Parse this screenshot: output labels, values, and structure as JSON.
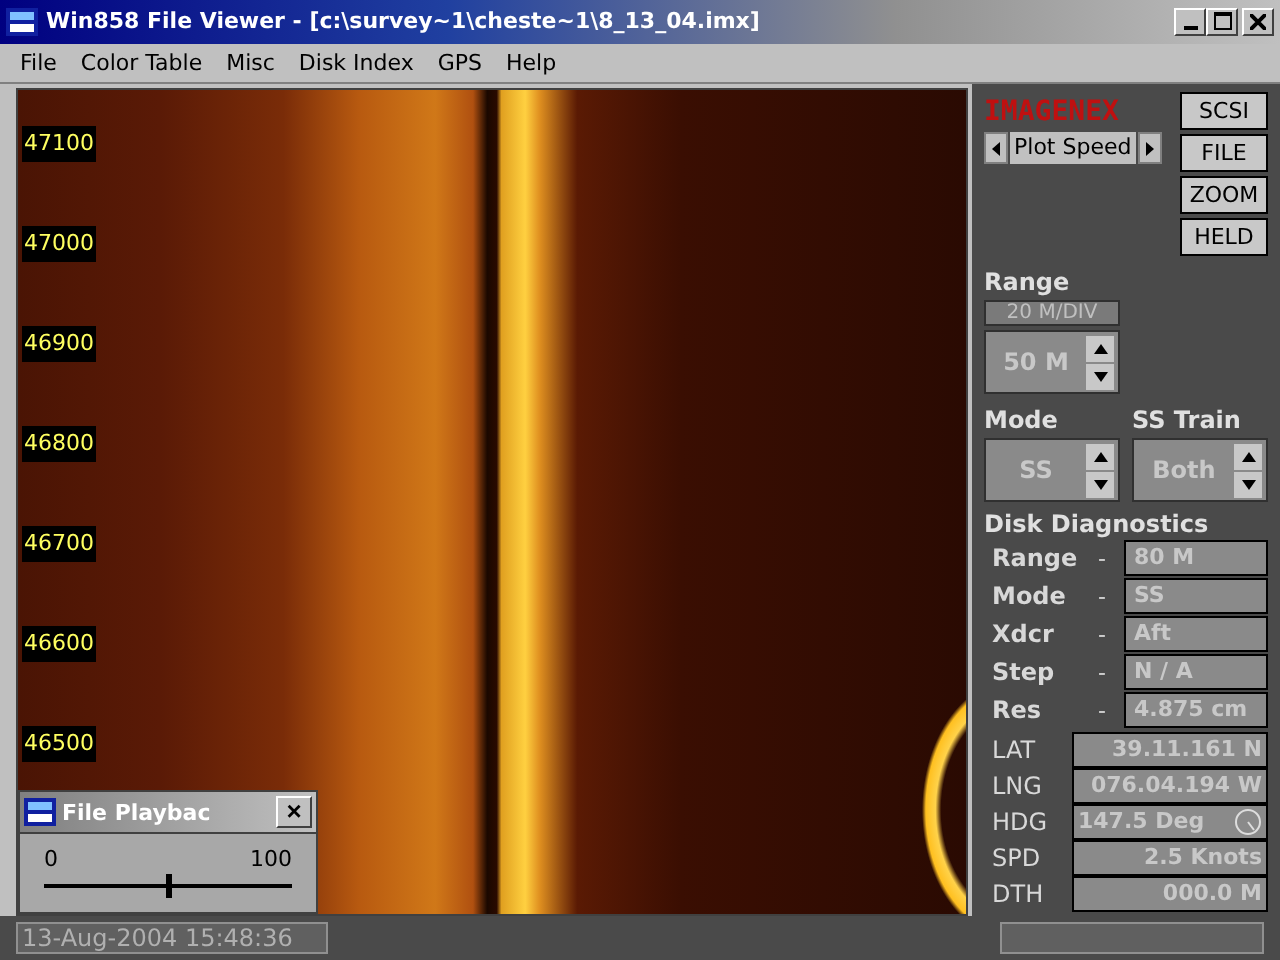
{
  "window": {
    "title": "Win858 File Viewer - [c:\\survey~1\\cheste~1\\8_13_04.imx]"
  },
  "menu": [
    "File",
    "Color Table",
    "Misc",
    "Disk Index",
    "GPS",
    "Help"
  ],
  "depth_markers": [
    "47100",
    "47000",
    "46900",
    "46800",
    "46700",
    "46600",
    "46500"
  ],
  "playback": {
    "title": "File Playbac",
    "min": "0",
    "max": "100",
    "close": "×",
    "level": 0.5
  },
  "status": {
    "datetime": "13-Aug-2004  15:48:36"
  },
  "panel": {
    "logo": "IMAGENEX",
    "plot_speed": "Plot Speed",
    "buttons": [
      "SCSI",
      "FILE",
      "ZOOM",
      "HELD"
    ],
    "range": {
      "label": "Range",
      "division": "20 M/DIV",
      "value": "50 M"
    },
    "mode": {
      "label": "Mode",
      "value": "SS"
    },
    "ss_train": {
      "label": "SS Train",
      "value": "Both"
    },
    "diagnostics": {
      "title": "Disk Diagnostics",
      "rows": [
        {
          "label": "Range",
          "separator": "-",
          "value": "80 M"
        },
        {
          "label": "Mode",
          "separator": "-",
          "value": "SS"
        },
        {
          "label": "Xdcr",
          "separator": "-",
          "value": "Aft"
        },
        {
          "label": "Step",
          "separator": "-",
          "value": "N / A"
        },
        {
          "label": "Res",
          "separator": "-",
          "value": "4.875 cm"
        }
      ]
    },
    "nav": [
      {
        "label": "LAT",
        "value": "39.11.161 N",
        "kind": "text"
      },
      {
        "label": "LNG",
        "value": "076.04.194 W",
        "kind": "text"
      },
      {
        "label": "HDG",
        "value": "147.5 Deg",
        "kind": "compass"
      },
      {
        "label": "SPD",
        "value": "2.5 Knots",
        "kind": "text"
      },
      {
        "label": "DTH",
        "value": "000.0 M",
        "kind": "text"
      }
    ]
  }
}
